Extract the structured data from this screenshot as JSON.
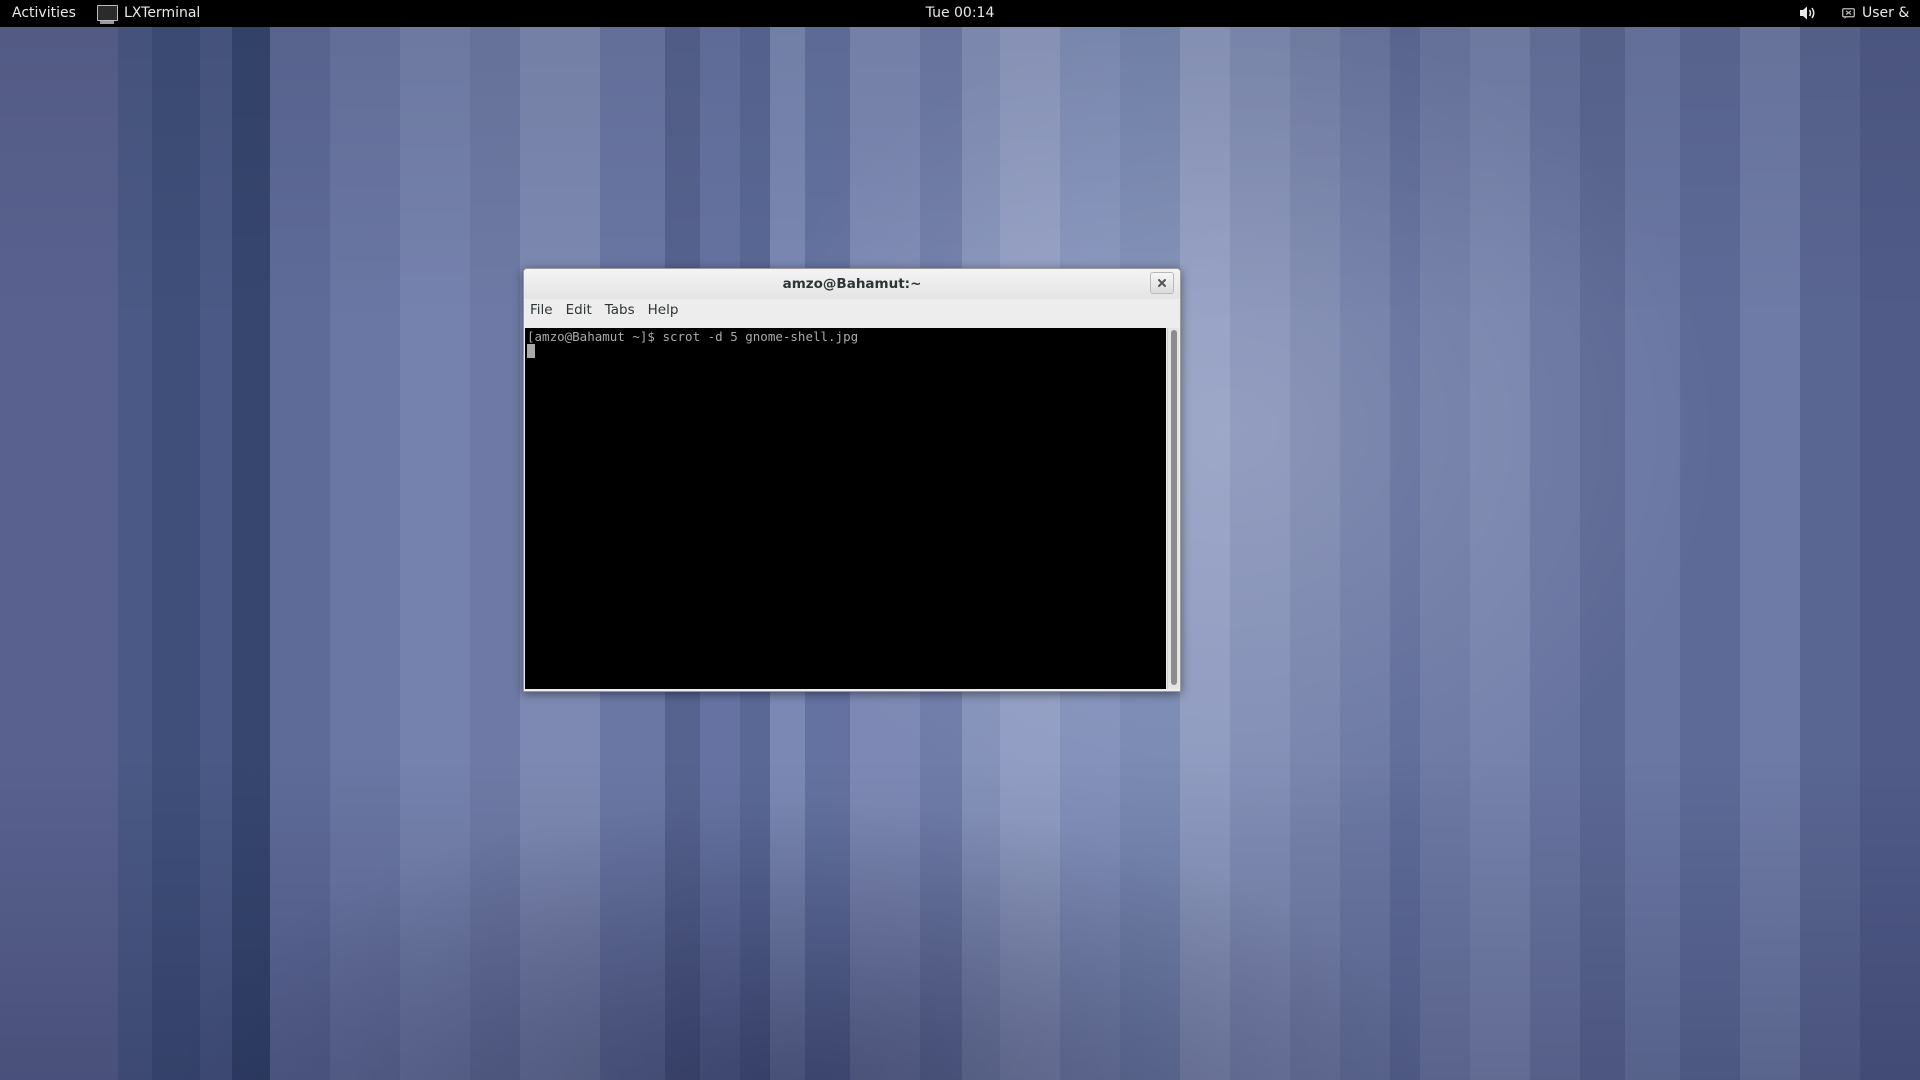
{
  "top_bar": {
    "activities_label": "Activities",
    "app_name": "LXTerminal",
    "app_icon": "terminal-icon",
    "clock": "Tue 00:14",
    "volume_icon": "volume-icon",
    "user_status_icon": "user-status-icon",
    "user_label": "User &"
  },
  "terminal": {
    "title": "amzo@Bahamut:~",
    "close_icon": "close-icon",
    "menu": [
      "File",
      "Edit",
      "Tabs",
      "Help"
    ],
    "lines": [
      "[amzo@Bahamut ~]$ scrot -d 5 gnome-shell.jpg"
    ]
  },
  "colors": {
    "top_bar_bg": "#000000",
    "terminal_bg": "#000000",
    "terminal_fg": "#aaaaaa",
    "window_chrome": "#ededed"
  }
}
